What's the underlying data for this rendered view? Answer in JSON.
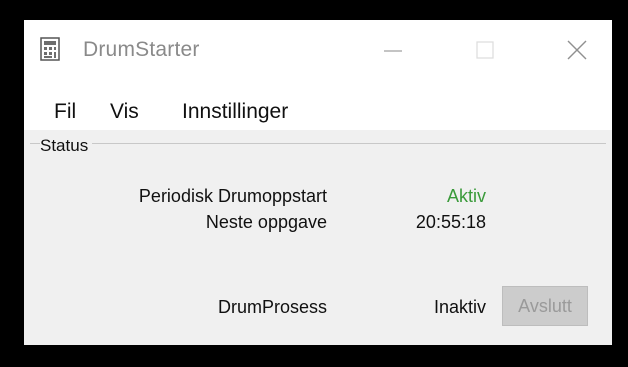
{
  "window": {
    "title": "DrumStarter",
    "controls": {
      "minimize_icon": "minimize-icon",
      "maximize_icon": "maximize-icon",
      "close_icon": "close-icon"
    }
  },
  "menu": {
    "items": [
      "Fil",
      "Vis",
      "Innstillinger"
    ]
  },
  "status": {
    "group_label": "Status",
    "periodic_label": "Periodisk Drumoppstart",
    "periodic_value": "Aktiv",
    "next_task_label": "Neste oppgave",
    "next_task_value": "20:55:18",
    "process_label": "DrumProsess",
    "process_value": "Inaktiv",
    "quit_button": "Avslutt"
  },
  "colors": {
    "active": "#3a9a3a",
    "disabled_button_bg": "#cccccc",
    "title_text": "#8a8a8a"
  }
}
